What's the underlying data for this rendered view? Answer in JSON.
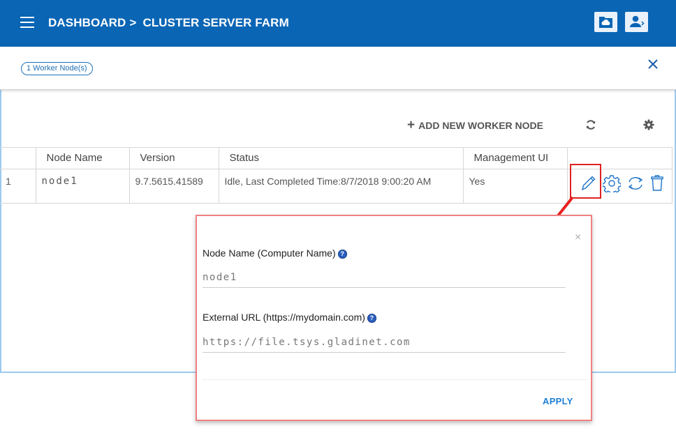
{
  "header": {
    "breadcrumb": [
      "DASHBOARD",
      ">",
      "CLUSTER SERVER FARM"
    ],
    "brand_color": "#0a65b5",
    "buttons": [
      {
        "name": "cloud-folder-icon"
      },
      {
        "name": "user-account-icon"
      }
    ]
  },
  "subheader": {
    "badge": "1 Worker Node(s)",
    "close_icon": "close-icon"
  },
  "toolbar": {
    "add_label": "ADD NEW WORKER NODE",
    "refresh_icon": "refresh-icon",
    "settings_icon": "gear-icon"
  },
  "table": {
    "columns": [
      "",
      "Node Name",
      "Version",
      "Status",
      "Management UI",
      ""
    ],
    "rows": [
      {
        "index": "1",
        "node_name": "node1",
        "version": "9.7.5615.41589",
        "status": "Idle, Last Completed Time:8/7/2018 9:00:20 AM",
        "management_ui": "Yes",
        "actions": [
          "edit-icon",
          "settings-icon",
          "sync-icon",
          "delete-icon"
        ]
      }
    ]
  },
  "dialog": {
    "close": "×",
    "node_name_label": "Node Name (Computer Name)",
    "node_name_value": "node1",
    "external_url_label": "External URL (https://mydomain.com)",
    "external_url_value": "https://file.tsys.gladinet.com",
    "help_glyph": "?",
    "apply_label": "APPLY"
  }
}
